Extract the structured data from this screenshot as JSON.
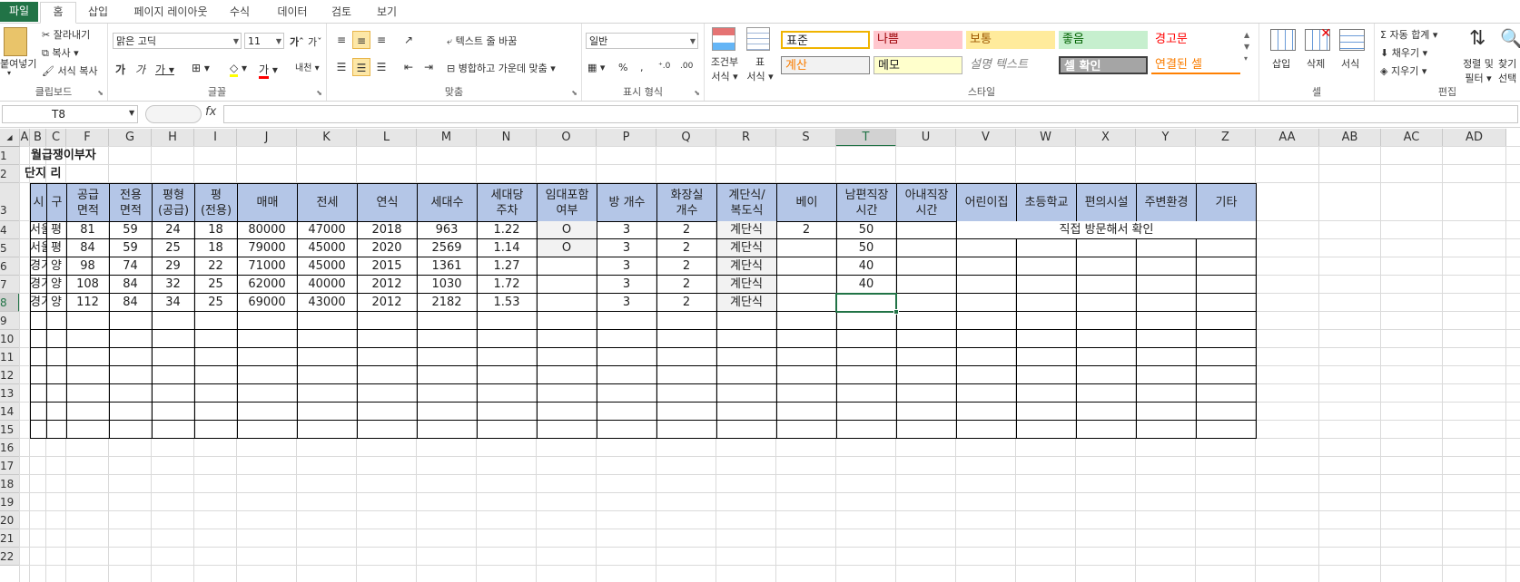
{
  "tabs": [
    "파일",
    "홈",
    "삽입",
    "페이지 레이아웃",
    "수식",
    "데이터",
    "검토",
    "보기"
  ],
  "ribbon": {
    "clipboard": {
      "paste": "붙여넣기",
      "cut": "잘라내기",
      "copy": "복사",
      "format_painter": "서식 복사",
      "label": "클립보드"
    },
    "font": {
      "name": "맑은 고딕",
      "size": "11",
      "label": "글꼴"
    },
    "align": {
      "wrap": "텍스트 줄 바꿈",
      "merge": "병합하고 가운데 맞춤",
      "label": "맞춤"
    },
    "number": {
      "format": "일반",
      "label": "표시 형식"
    },
    "styles": {
      "conditional": "조건부",
      "conditional2": "서식",
      "table": "표",
      "table2": "서식",
      "label": "스타일",
      "items": [
        "표준",
        "나쁨",
        "보통",
        "좋음",
        "경고문",
        "계산",
        "메모",
        "설명 텍스트",
        "셀 확인",
        "연결된 셀"
      ]
    },
    "cells": {
      "insert": "삽입",
      "delete": "삭제",
      "format": "서식",
      "label": "셀"
    },
    "editing": {
      "autosum": "자동 합계",
      "fill": "채우기",
      "clear": "지우기",
      "sort": "정렬 및",
      "sort2": "필터",
      "find": "찾기",
      "find2": "선택",
      "label": "편집"
    }
  },
  "formula": {
    "namebox": "T8",
    "fx": "fx"
  },
  "columns": [
    "A",
    "B",
    "C",
    "F",
    "G",
    "H",
    "I",
    "J",
    "K",
    "L",
    "M",
    "N",
    "O",
    "P",
    "Q",
    "R",
    "S",
    "T",
    "U",
    "V",
    "W",
    "X",
    "Y",
    "Z",
    "AA",
    "AB",
    "AC",
    "AD"
  ],
  "rows": [
    "1",
    "2",
    "3",
    "4",
    "5",
    "6",
    "7",
    "8",
    "9",
    "10",
    "11",
    "12",
    "13",
    "14",
    "15",
    "16",
    "17",
    "18",
    "19",
    "20",
    "21",
    "22"
  ],
  "sheet": {
    "title": "월급쟁이부자",
    "subtitle": "단지 리",
    "headers": [
      [
        "시"
      ],
      [
        "구"
      ],
      [
        "공급",
        "면적"
      ],
      [
        "전용",
        "면적"
      ],
      [
        "평형",
        "(공급)"
      ],
      [
        "평",
        "(전용)"
      ],
      [
        "매매"
      ],
      [
        "전세"
      ],
      [
        "연식"
      ],
      [
        "세대수"
      ],
      [
        "세대당",
        "주차"
      ],
      [
        "임대포함",
        "여부"
      ],
      [
        "방 개수"
      ],
      [
        "화장실",
        "개수"
      ],
      [
        "계단식/",
        "복도식"
      ],
      [
        "베이"
      ],
      [
        "남편직장",
        "시간"
      ],
      [
        "아내직장",
        "시간"
      ],
      [
        "어린이집"
      ],
      [
        "초등학교"
      ],
      [
        "편의시설"
      ],
      [
        "주변환경"
      ],
      [
        "기타"
      ]
    ],
    "data": [
      [
        "서울시",
        "평",
        "81",
        "59",
        "24",
        "18",
        "80000",
        "47000",
        "2018",
        "963",
        "1.22",
        "O",
        "3",
        "2",
        "계단식",
        "2",
        "50"
      ],
      [
        "서울시",
        "평",
        "84",
        "59",
        "25",
        "18",
        "79000",
        "45000",
        "2020",
        "2569",
        "1.14",
        "O",
        "3",
        "2",
        "계단식",
        "",
        "50"
      ],
      [
        "경기도",
        "양",
        "98",
        "74",
        "29",
        "22",
        "71000",
        "45000",
        "2015",
        "1361",
        "1.27",
        "",
        "3",
        "2",
        "계단식",
        "",
        "40"
      ],
      [
        "경기도",
        "양",
        "108",
        "84",
        "32",
        "25",
        "62000",
        "40000",
        "2012",
        "1030",
        "1.72",
        "",
        "3",
        "2",
        "계단식",
        "",
        "40"
      ],
      [
        "경기도",
        "양",
        "112",
        "84",
        "34",
        "25",
        "69000",
        "43000",
        "2012",
        "2182",
        "1.53",
        "",
        "3",
        "2",
        "계단식",
        "",
        ""
      ]
    ],
    "note": "직접 방문해서 확인"
  }
}
